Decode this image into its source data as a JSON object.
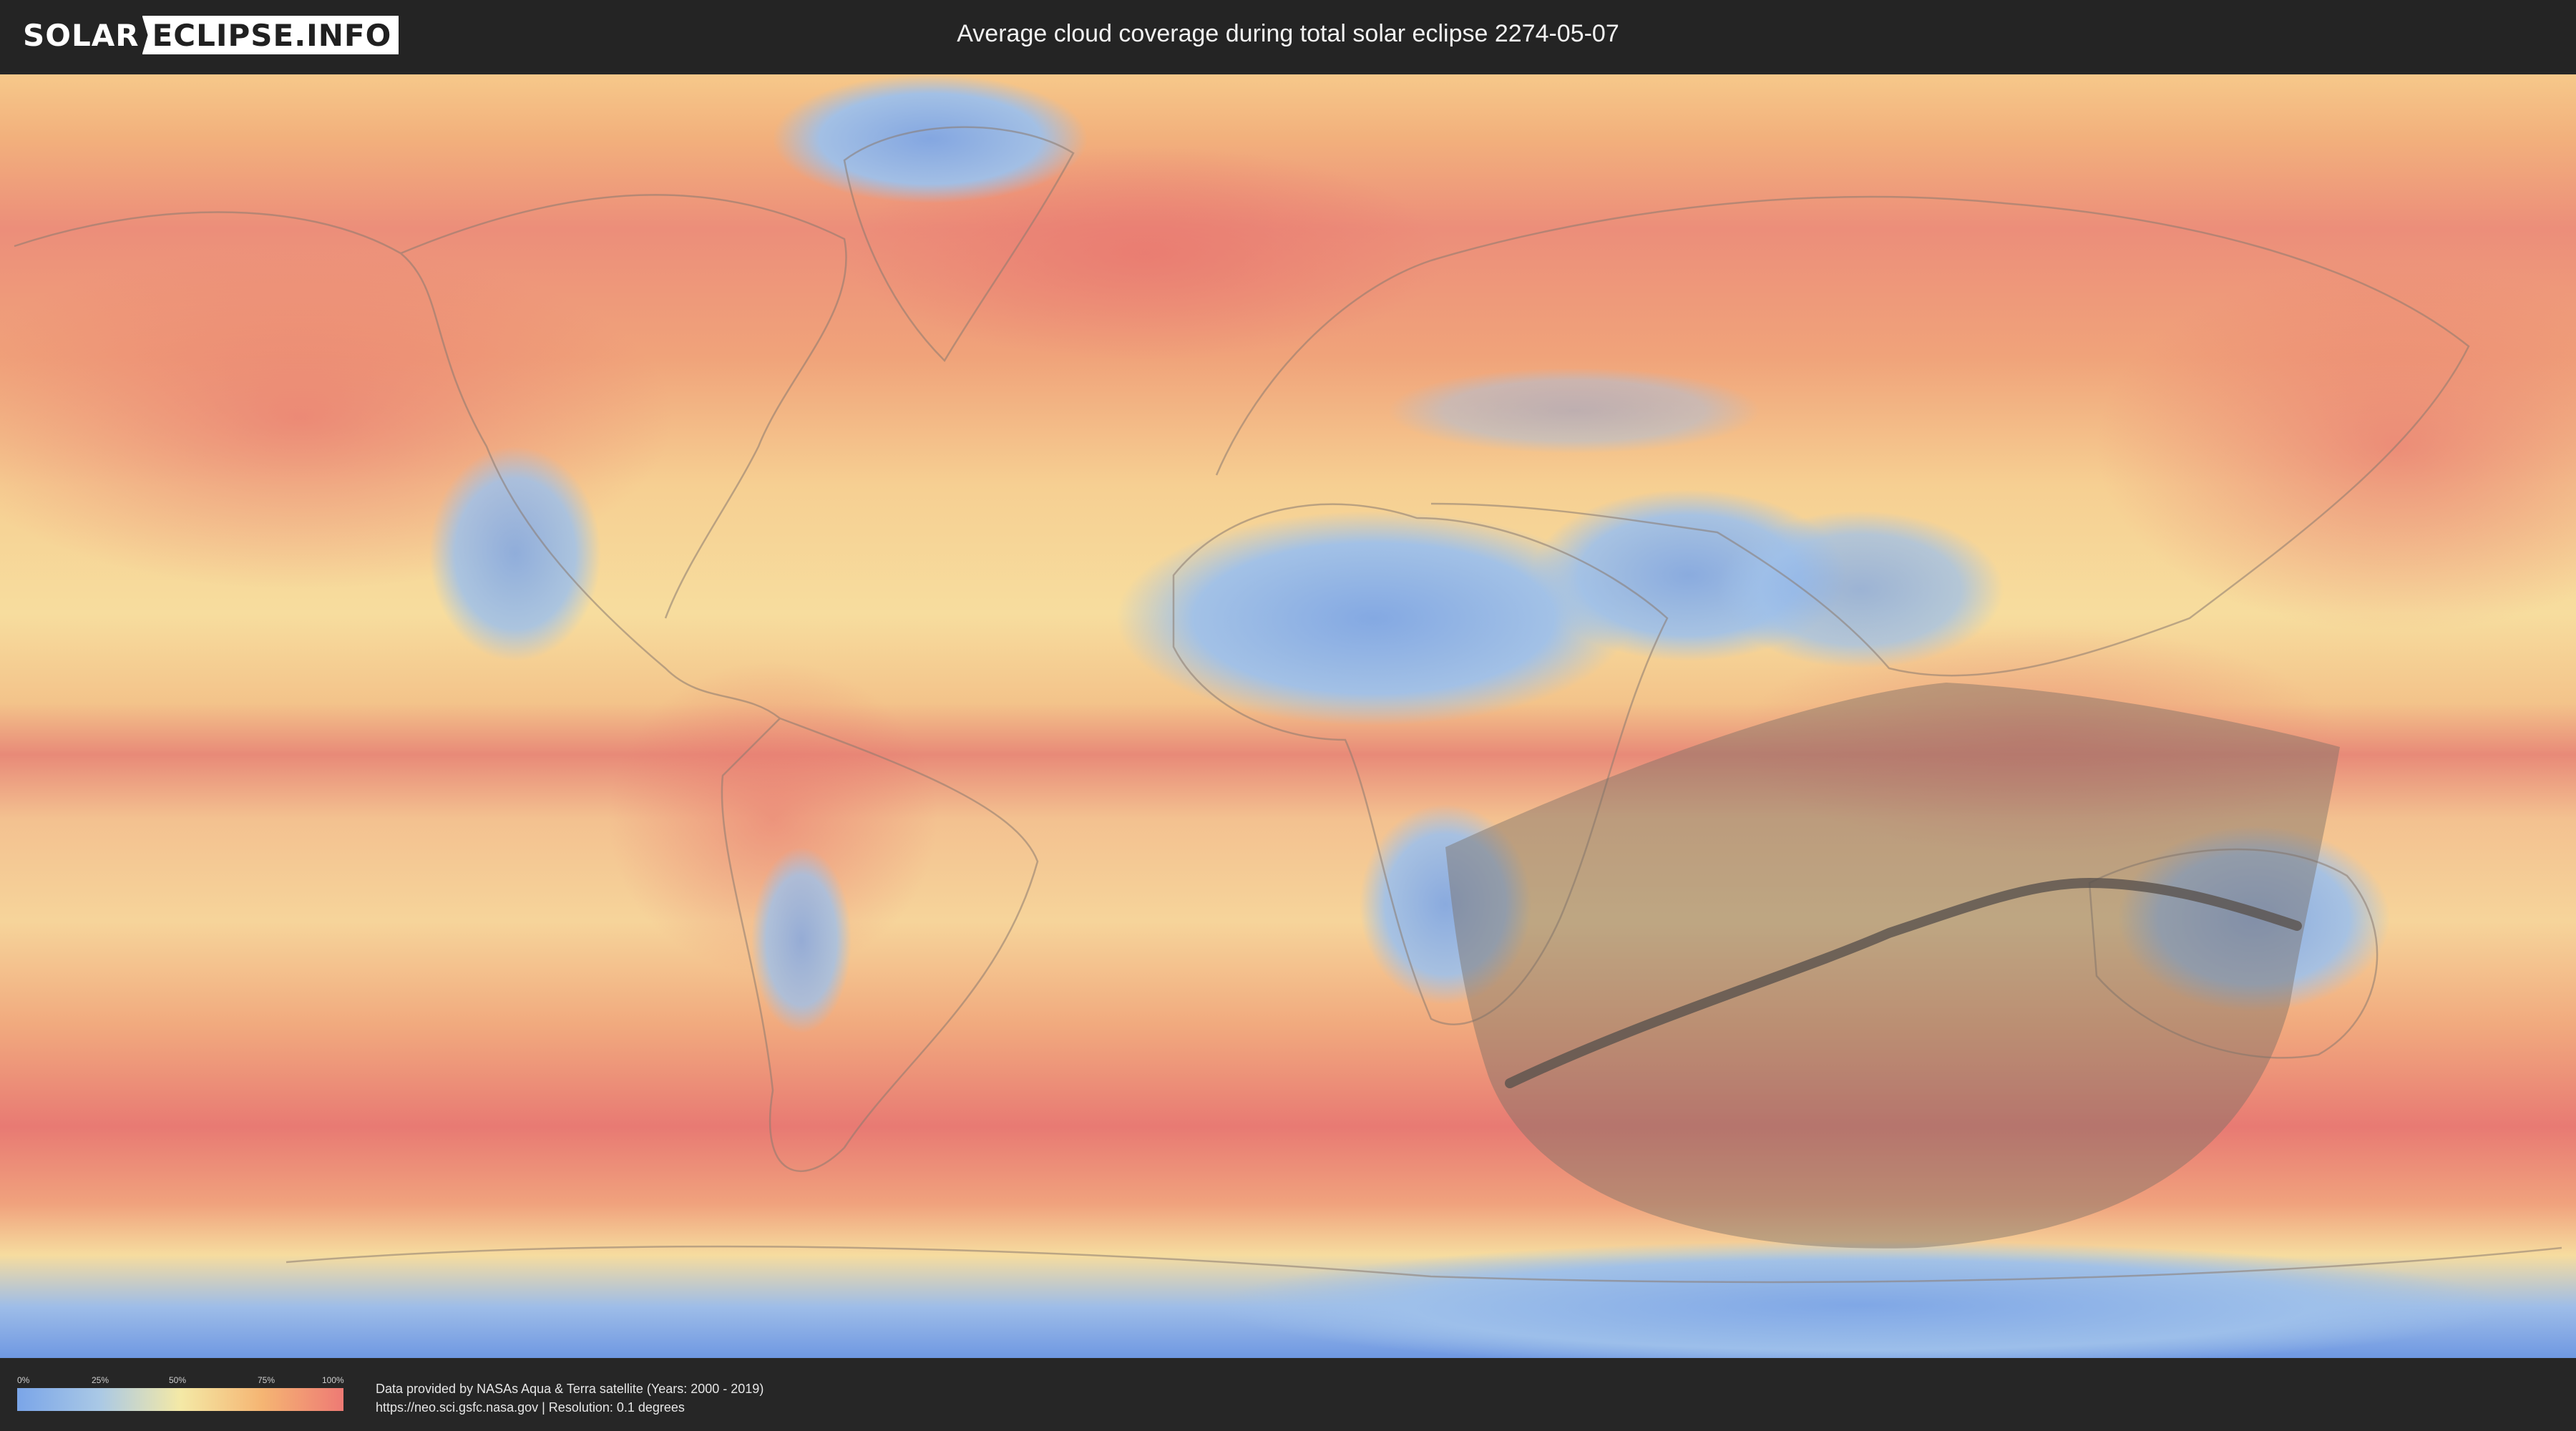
{
  "header": {
    "logo_part1": "SOLAR",
    "logo_part2": "ECLIPSE.INFO",
    "title": "Average cloud coverage during total solar eclipse 2274-05-07"
  },
  "legend": {
    "ticks": [
      "0%",
      "25%",
      "50%",
      "75%",
      "100%"
    ],
    "colors": [
      "#7aa5e8",
      "#a9c8e6",
      "#f4e9a6",
      "#f5b573",
      "#ee7a74"
    ]
  },
  "credits": {
    "line1": "Data provided by NASAs Aqua & Terra satellite (Years: 2000 - 2019)",
    "line2": "https://neo.sci.gsfc.nasa.gov | Resolution: 0.1 degrees"
  },
  "map": {
    "projection": "equirectangular",
    "layer": "cloud-coverage",
    "eclipse_overlay": "partial-visibility-region",
    "totality_path": "central-line"
  }
}
